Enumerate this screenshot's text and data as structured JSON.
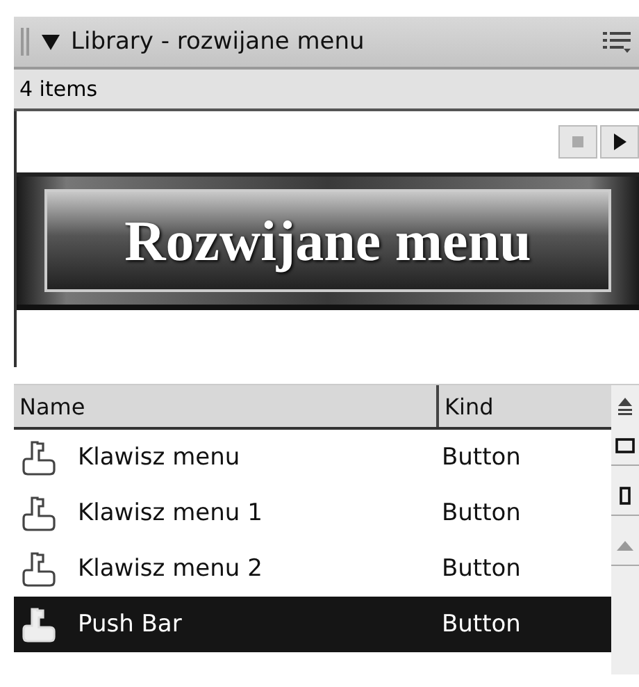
{
  "panel": {
    "title": "Library - rozwijane menu",
    "count": "4 items"
  },
  "preview": {
    "button_label": "Rozwijane menu"
  },
  "table": {
    "columns": [
      "Name",
      "Kind"
    ],
    "rows": [
      {
        "name": "Klawisz menu",
        "kind": "Button",
        "selected": false
      },
      {
        "name": "Klawisz menu 1",
        "kind": "Button",
        "selected": false
      },
      {
        "name": "Klawisz menu 2",
        "kind": "Button",
        "selected": false
      },
      {
        "name": "Push Bar",
        "kind": "Button",
        "selected": true
      }
    ]
  }
}
